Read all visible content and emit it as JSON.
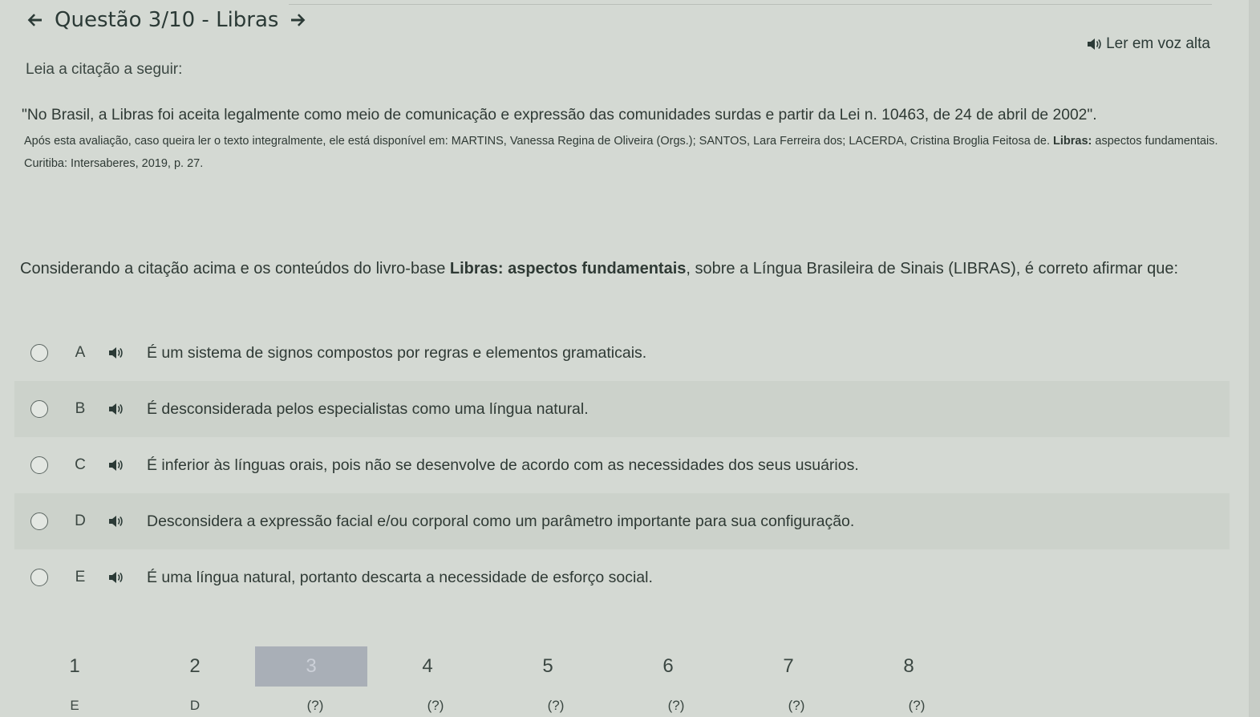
{
  "header": {
    "title": "Questão 3/10 - Libras",
    "read_aloud": "Ler em voz alta"
  },
  "content": {
    "intro": "Leia a citação a seguir:",
    "quote": "\"No Brasil, a Libras foi aceita legalmente como meio de comunicação e expressão das comunidades surdas e partir da Lei n. 10463, de 24 de abril de 2002\".",
    "source_prefix": "Após esta avaliação, caso queira ler o texto integralmente, ele está disponível em: MARTINS, Vanessa Regina de Oliveira (Orgs.); SANTOS, Lara Ferreira dos; LACERDA, Cristina Broglia Feitosa de. ",
    "source_book": "Libras:",
    "source_suffix": " aspectos fundamentais. Curitiba: Intersaberes, 2019, p. 27.",
    "question_prefix": "Considerando a citação acima e os conteúdos do livro-base ",
    "question_book": "Libras: aspectos fundamentais",
    "question_suffix": ", sobre a Língua Brasileira de Sinais (LIBRAS), é correto afirmar que:"
  },
  "options": [
    {
      "letter": "A",
      "text": "É um sistema de signos compostos por regras e elementos gramaticais."
    },
    {
      "letter": "B",
      "text": "É desconsiderada pelos especialistas como uma língua natural."
    },
    {
      "letter": "C",
      "text": "É inferior às línguas orais, pois não se desenvolve de acordo com as necessidades dos seus usuários."
    },
    {
      "letter": "D",
      "text": "Desconsidera a expressão facial e/ou corporal como um parâmetro importante para sua configuração."
    },
    {
      "letter": "E",
      "text": "É uma língua natural, portanto descarta a necessidade de esforço social."
    }
  ],
  "pager": {
    "pages": [
      "1",
      "2",
      "3",
      "4",
      "5",
      "6",
      "7",
      "8"
    ],
    "answers": [
      "E",
      "D",
      "(?)",
      "(?)",
      "(?)",
      "(?)",
      "(?)",
      "(?)"
    ],
    "current": "3"
  },
  "colors": {
    "background": "#d4d9d3",
    "text": "#2f3a35",
    "current_page": "#a9afb7"
  }
}
